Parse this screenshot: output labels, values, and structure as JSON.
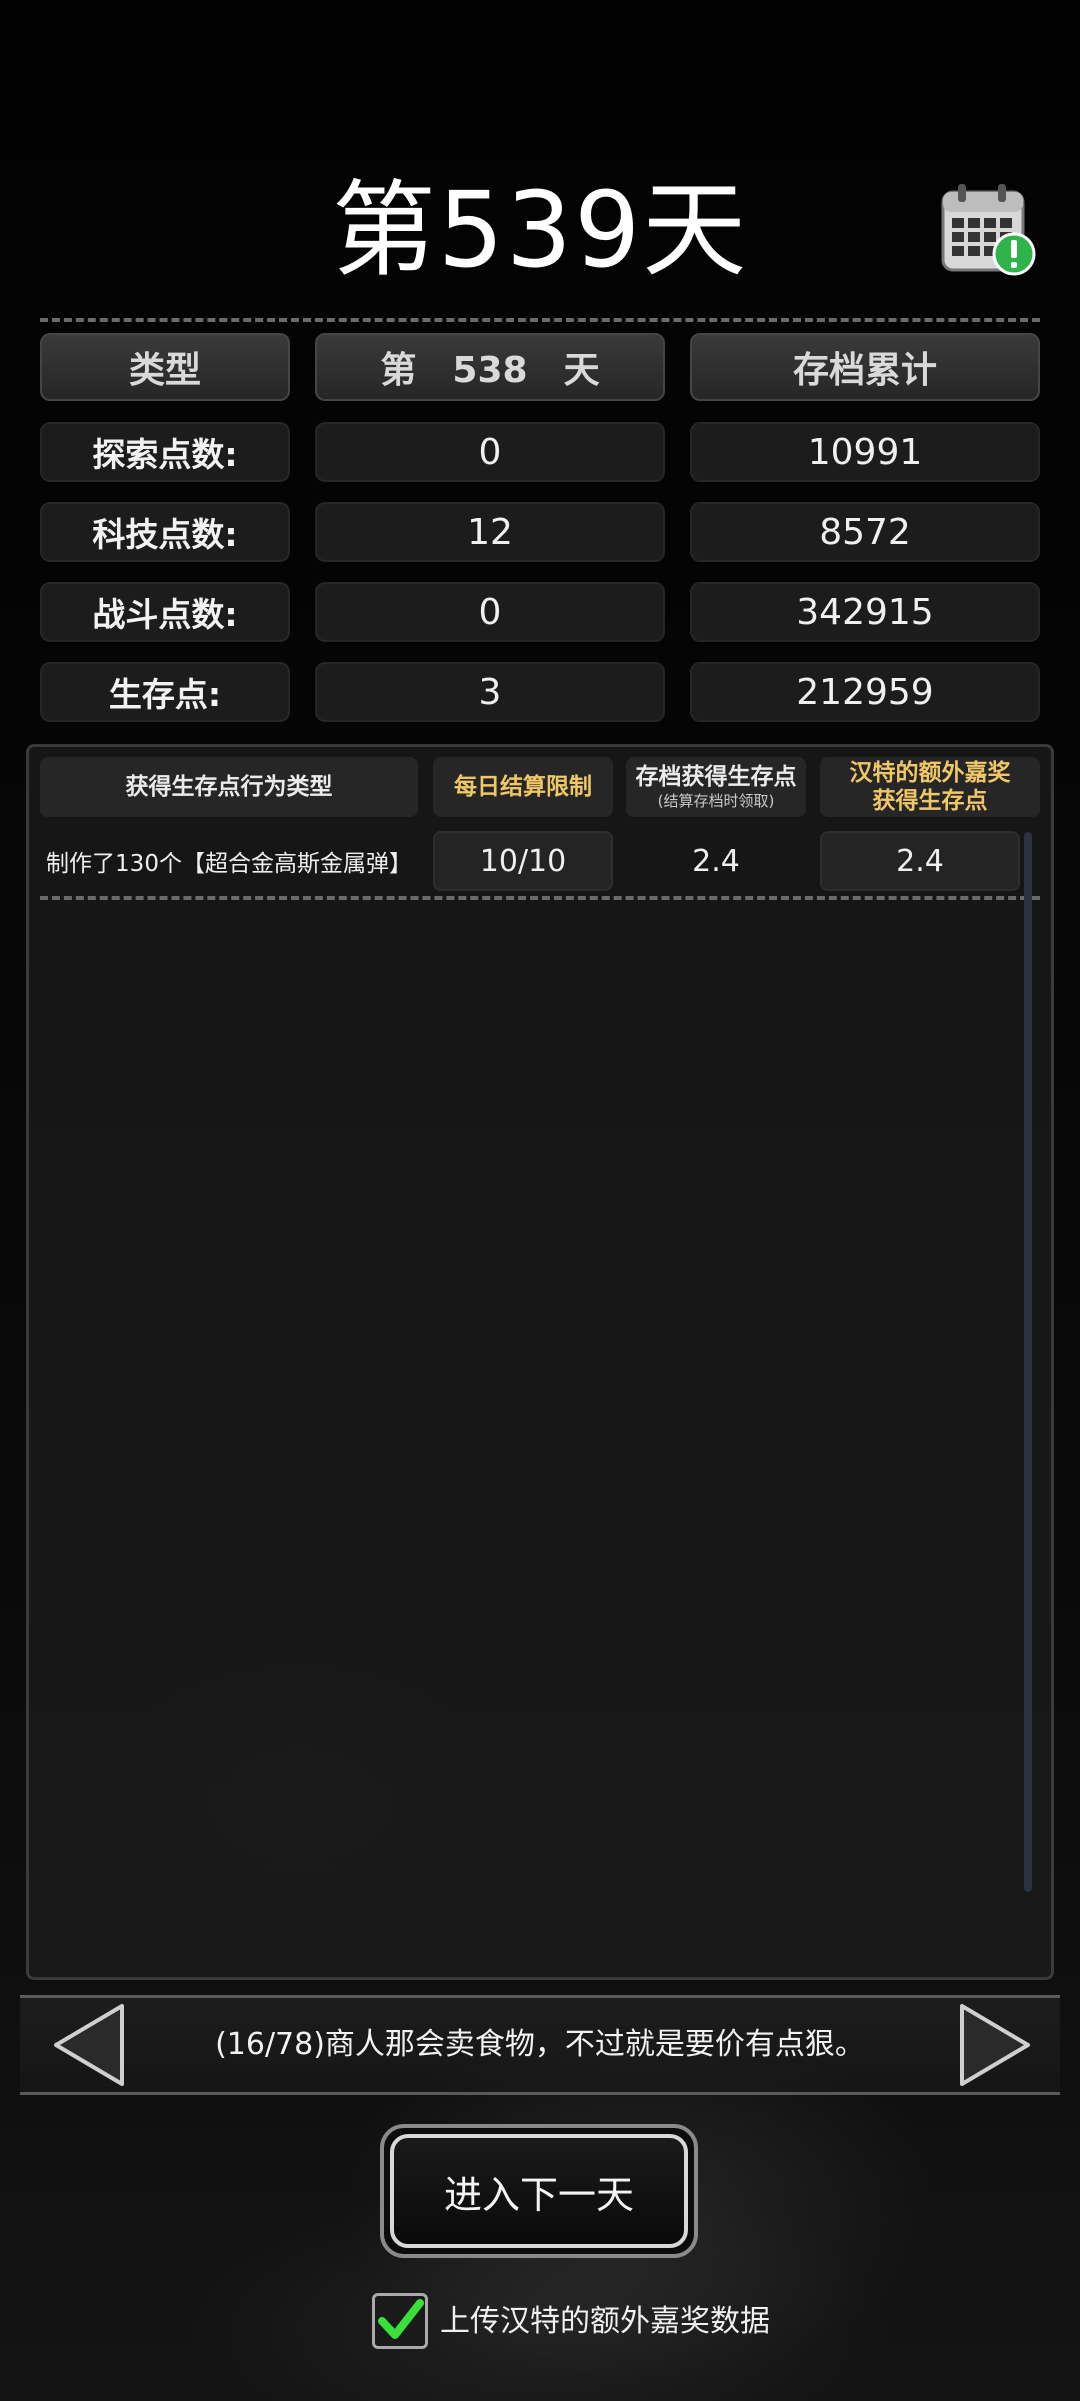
{
  "header": {
    "title": "第539天",
    "calendar_icon": "calendar-alert-icon"
  },
  "stats_table": {
    "headers": [
      "类型",
      "第　538　天",
      "存档累计"
    ],
    "rows": [
      {
        "label": "探索点数:",
        "day": "0",
        "total": "10991"
      },
      {
        "label": "科技点数:",
        "day": "12",
        "total": "8572"
      },
      {
        "label": "战斗点数:",
        "day": "0",
        "total": "342915"
      },
      {
        "label": "生存点:",
        "day": "3",
        "total": "212959"
      }
    ]
  },
  "points_panel": {
    "headers": {
      "type": "获得生存点行为类型",
      "limit": "每日结算限制",
      "save_points": "存档获得生存点",
      "save_points_note": "(结算存档时领取)",
      "bonus_line1": "汉特的额外嘉奖",
      "bonus_line2": "获得生存点"
    },
    "rows": [
      {
        "type": "制作了130个【超合金高斯金属弹】",
        "limit": "10/10",
        "save_points": "2.4",
        "bonus": "2.4"
      }
    ]
  },
  "tip": {
    "text": "(16/78)商人那会卖食物，不过就是要价有点狠。",
    "prev_icon": "triangle-left-icon",
    "next_icon": "triangle-right-icon"
  },
  "next_day_button": "进入下一天",
  "upload_checkbox": {
    "label": "上传汉特的额外嘉奖数据",
    "checked": true
  },
  "colors": {
    "gold_header": "#f0c766",
    "check_green": "#39e03a"
  }
}
